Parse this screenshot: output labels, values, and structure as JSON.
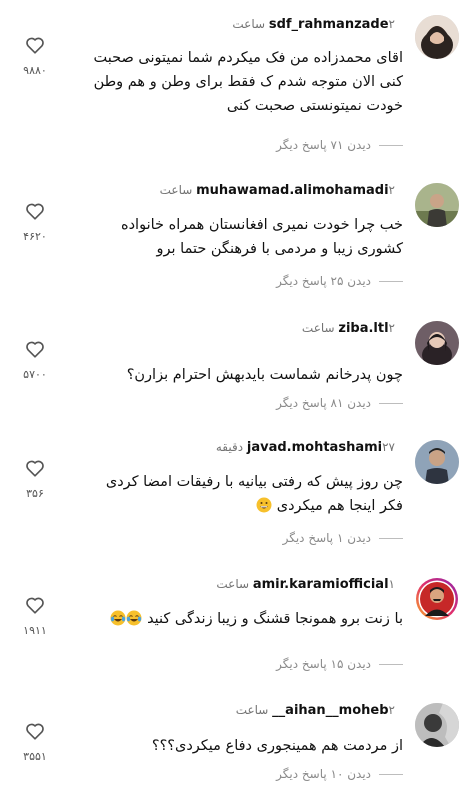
{
  "comments": [
    {
      "username": "sdf_rahmanzade",
      "time": "۲ ساعت",
      "lines": [
        "اقای محمدزاده من فک میکردم شما نمیتونی صحبت",
        "کنی الان متوجه شدم ک فقط برای وطن و هم وطن",
        "خودت نمیتونستی صحبت کنی"
      ],
      "replies": "دیدن ۷۱ پاسخ دیگر",
      "likes": "۹۸۸۰",
      "avatar_color": "#d8c3b3"
    },
    {
      "username": "muhawamad.alimohamadi",
      "time": "۲ ساعت",
      "lines": [
        "خب چرا خودت نمیری افغانستان همراه خانواده",
        "کشوری زیبا و مردمی با فرهنگن حتما برو"
      ],
      "replies": "دیدن ۲۵ پاسخ دیگر",
      "likes": "۴۶۲۰",
      "avatar_color": "#8b9a6b"
    },
    {
      "username": "ziba.ltl",
      "time": "۲ ساعت",
      "lines": [
        "چون پدرخانم شماست بایدبهش احترام بزارن؟"
      ],
      "replies": "دیدن ۸۱ پاسخ دیگر",
      "likes": "۵۷۰۰",
      "avatar_color": "#5a4a52"
    },
    {
      "username": "javad.mohtashami",
      "time": "۲۷ دقیقه",
      "lines": [
        "چن روز پیش که رفتی بیانیه با رفیقات امضا کردی",
        "فکر اینجا هم میکردی"
      ],
      "emoji_line": 1,
      "emoji": "grin",
      "replies": "دیدن ۱ پاسخ دیگر",
      "likes": "۳۵۶",
      "avatar_color": "#7a8aa0"
    },
    {
      "username": "amir.karamiofficial",
      "time": "۱ ساعت",
      "lines": [
        "با زنت برو همونجا قشنگ و زیبا زندگی کنید"
      ],
      "emoji_line": 0,
      "emoji": "joy-double",
      "replies": "دیدن ۱۵ پاسخ دیگر",
      "likes": "۱۹۱۱",
      "avatar_color": "#c0392b"
    },
    {
      "username": "__aihan__moheb",
      "time": "۲ ساعت",
      "lines": [
        "از مردمت هم همینجوری دفاع میکردی؟؟؟"
      ],
      "replies": "دیدن ۱۰ پاسخ دیگر",
      "likes": "۳۵۵۱",
      "avatar_color": "#3a3a3a"
    }
  ]
}
